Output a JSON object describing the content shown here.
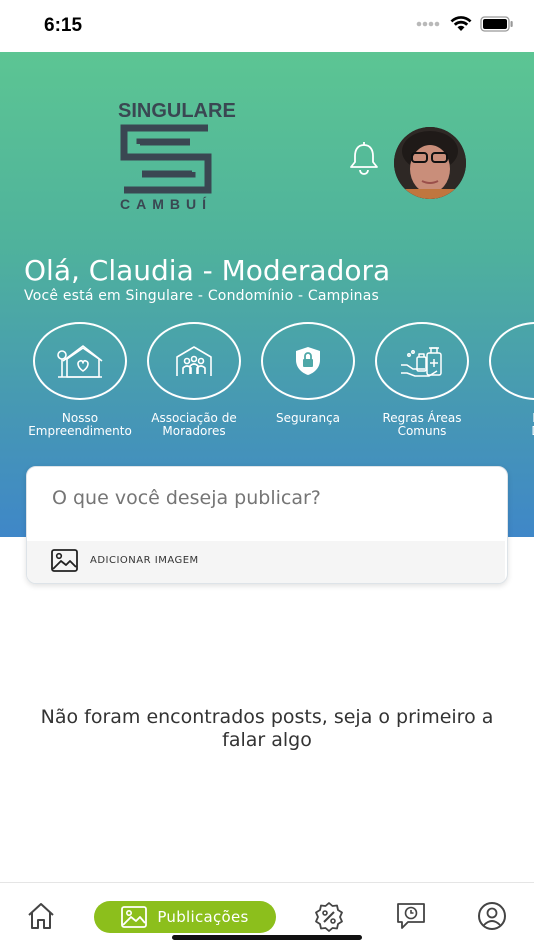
{
  "status": {
    "time": "6:15"
  },
  "colors": {
    "accent": "#8cbf1c",
    "gradient_top": "#5cc593",
    "gradient_bottom": "#3f87c8"
  },
  "logo": {
    "top_text": "SINGULARE",
    "bottom_text": "CAMBUÍ"
  },
  "header": {
    "greeting": "Olá, Claudia - Moderadora",
    "location": "Você está em Singulare - Condomínio - Campinas"
  },
  "shortcuts": [
    {
      "label": "Nosso Empreendimento",
      "icon": "house-heart-icon"
    },
    {
      "label": "Associação de Moradores",
      "icon": "people-house-icon"
    },
    {
      "label": "Segurança",
      "icon": "shield-lock-icon"
    },
    {
      "label": "Regras Áreas Comuns",
      "icon": "hand-sanitizer-icon"
    },
    {
      "label": "E\nD",
      "icon": "partial-icon"
    }
  ],
  "compose": {
    "placeholder": "O que você deseja publicar?",
    "add_image": "ADICIONAR IMAGEM"
  },
  "empty_state": "Não foram encontrados posts, seja o primeiro a falar algo",
  "tabbar": {
    "items": [
      {
        "icon": "home-icon"
      },
      {
        "icon": "image-icon",
        "label": "Publicações",
        "active": true
      },
      {
        "icon": "discount-badge-icon"
      },
      {
        "icon": "chat-clock-icon"
      },
      {
        "icon": "user-icon"
      }
    ]
  }
}
